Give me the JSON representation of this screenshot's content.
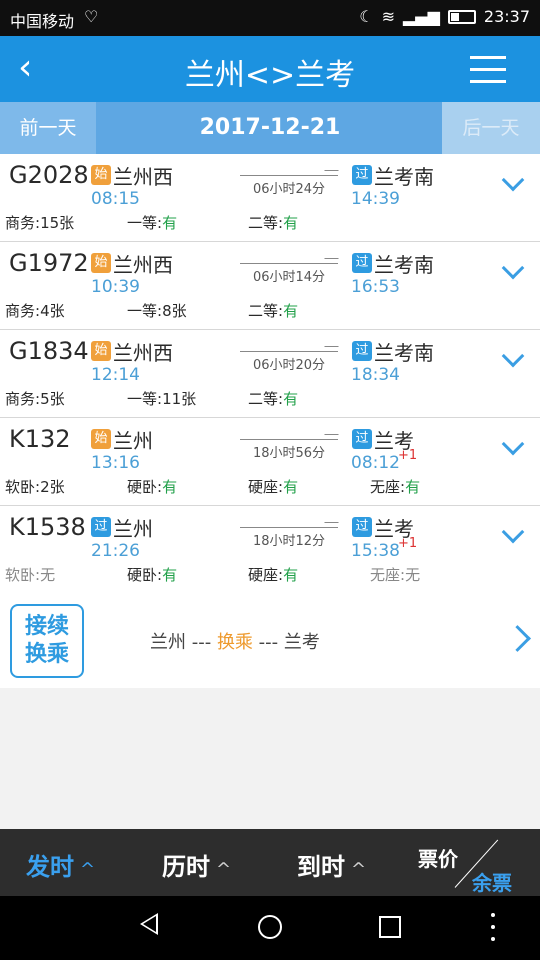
{
  "status_bar": {
    "carrier": "中国移动",
    "time": "23:37"
  },
  "header": {
    "title": "兰州<>兰考"
  },
  "date_bar": {
    "prev_label": "前一天",
    "date": "2017-12-21",
    "next_label": "后一天"
  },
  "trains": [
    {
      "code": "G2028",
      "dep_tag": "始",
      "dep_station": "兰州西",
      "dep_time": "08:15",
      "duration": "06小时24分",
      "arr_tag": "过",
      "arr_station": "兰考南",
      "arr_time": "14:39",
      "arr_plus": "",
      "seats": [
        {
          "label": "商务:",
          "value": "15张"
        },
        {
          "label": "一等:",
          "value": "有"
        },
        {
          "label": "二等:",
          "value": "有"
        }
      ]
    },
    {
      "code": "G1972",
      "dep_tag": "始",
      "dep_station": "兰州西",
      "dep_time": "10:39",
      "duration": "06小时14分",
      "arr_tag": "过",
      "arr_station": "兰考南",
      "arr_time": "16:53",
      "arr_plus": "",
      "seats": [
        {
          "label": "商务:",
          "value": "4张"
        },
        {
          "label": "一等:",
          "value": "8张"
        },
        {
          "label": "二等:",
          "value": "有"
        }
      ]
    },
    {
      "code": "G1834",
      "dep_tag": "始",
      "dep_station": "兰州西",
      "dep_time": "12:14",
      "duration": "06小时20分",
      "arr_tag": "过",
      "arr_station": "兰考南",
      "arr_time": "18:34",
      "arr_plus": "",
      "seats": [
        {
          "label": "商务:",
          "value": "5张"
        },
        {
          "label": "一等:",
          "value": "11张"
        },
        {
          "label": "二等:",
          "value": "有"
        }
      ]
    },
    {
      "code": "K132",
      "dep_tag": "始",
      "dep_station": "兰州",
      "dep_time": "13:16",
      "duration": "18小时56分",
      "arr_tag": "过",
      "arr_station": "兰考",
      "arr_time": "08:12",
      "arr_plus": "+1",
      "seats": [
        {
          "label": "软卧:",
          "value": "2张"
        },
        {
          "label": "硬卧:",
          "value": "有"
        },
        {
          "label": "硬座:",
          "value": "有"
        },
        {
          "label": "无座:",
          "value": "有"
        }
      ]
    },
    {
      "code": "K1538",
      "dep_tag": "过",
      "dep_station": "兰州",
      "dep_time": "21:26",
      "duration": "18小时12分",
      "arr_tag": "过",
      "arr_station": "兰考",
      "arr_time": "15:38",
      "arr_plus": "+1",
      "seats": [
        {
          "label": "软卧:",
          "value": "无"
        },
        {
          "label": "硬卧:",
          "value": "有"
        },
        {
          "label": "硬座:",
          "value": "有"
        },
        {
          "label": "无座:",
          "value": "无"
        }
      ]
    }
  ],
  "transfer": {
    "button_line1": "接续",
    "button_line2": "换乘",
    "from": "兰州",
    "sep1": " --- ",
    "via": "换乘",
    "sep2": " --- ",
    "to": "兰考"
  },
  "sort_bar": {
    "depart": "发时",
    "duration": "历时",
    "arrive": "到时",
    "price": "票价",
    "remaining": "余票",
    "caret": "^"
  },
  "colors": {
    "header_blue": "#1c92e0",
    "accent_blue": "#3aa0ef",
    "available_green": "#22a04a",
    "origin_tag_orange": "#f0a03b",
    "pass_tag_blue": "#2e9be0"
  }
}
